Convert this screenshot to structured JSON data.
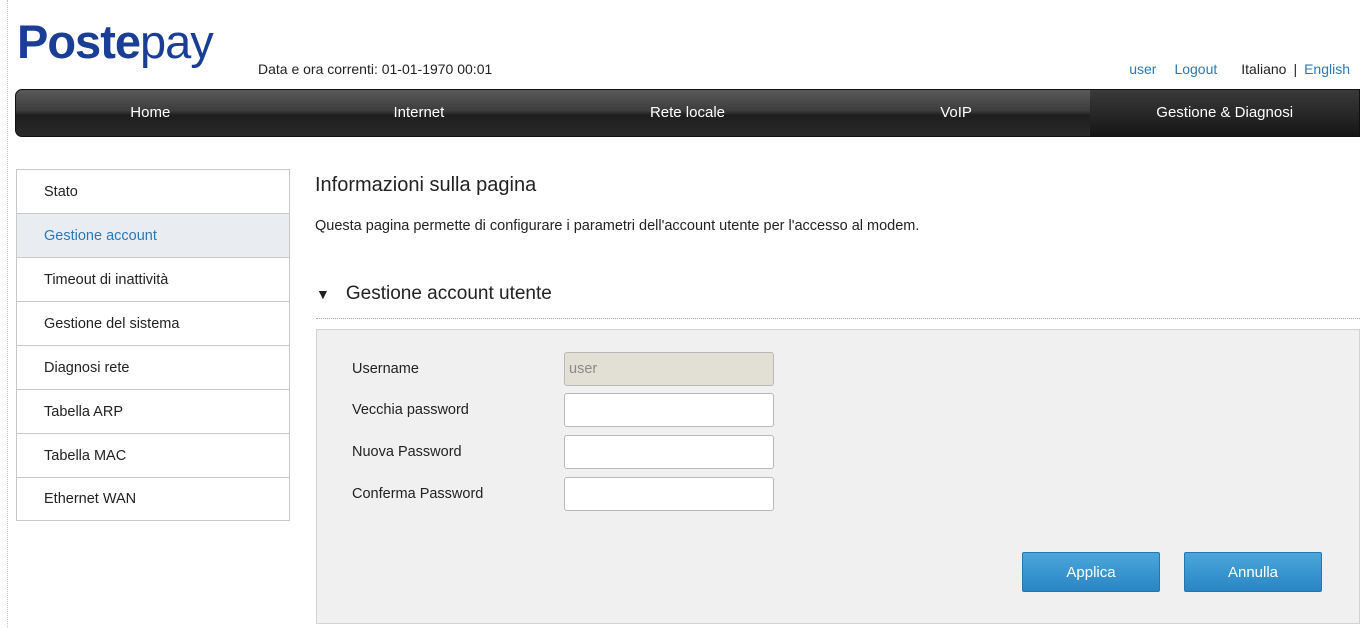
{
  "header": {
    "logo_bold": "Poste",
    "logo_light": "pay",
    "datetime_label": "Data e ora correnti: 01-01-1970 00:01",
    "user_link": "user",
    "logout_link": "Logout",
    "lang_current": "Italiano",
    "lang_separator": "|",
    "lang_other": "English"
  },
  "nav": {
    "items": [
      {
        "label": "Home"
      },
      {
        "label": "Internet"
      },
      {
        "label": "Rete locale"
      },
      {
        "label": "VoIP"
      },
      {
        "label": "Gestione & Diagnosi"
      }
    ],
    "active": "Gestione & Diagnosi"
  },
  "sidebar": {
    "items": [
      {
        "label": "Stato"
      },
      {
        "label": "Gestione account"
      },
      {
        "label": "Timeout di inattività"
      },
      {
        "label": "Gestione del sistema"
      },
      {
        "label": "Diagnosi rete"
      },
      {
        "label": "Tabella ARP"
      },
      {
        "label": "Tabella MAC"
      },
      {
        "label": "Ethernet WAN"
      }
    ],
    "active": "Gestione account"
  },
  "main": {
    "title": "Informazioni sulla pagina",
    "description": "Questa pagina permette di configurare i parametri dell'account utente per l'accesso al modem.",
    "section_title": "Gestione account utente",
    "section_toggle_icon": "▼"
  },
  "form": {
    "username_label": "Username",
    "username_value": "user",
    "old_password_label": "Vecchia password",
    "old_password_value": "",
    "new_password_label": "Nuova Password",
    "new_password_value": "",
    "confirm_password_label": "Conferma Password",
    "confirm_password_value": "",
    "apply_button": "Applica",
    "cancel_button": "Annulla"
  },
  "colors": {
    "brand": "#1a3e96",
    "link": "#2a78b6",
    "button": "#3596d0",
    "nav_dark": "#2a2a2a"
  }
}
